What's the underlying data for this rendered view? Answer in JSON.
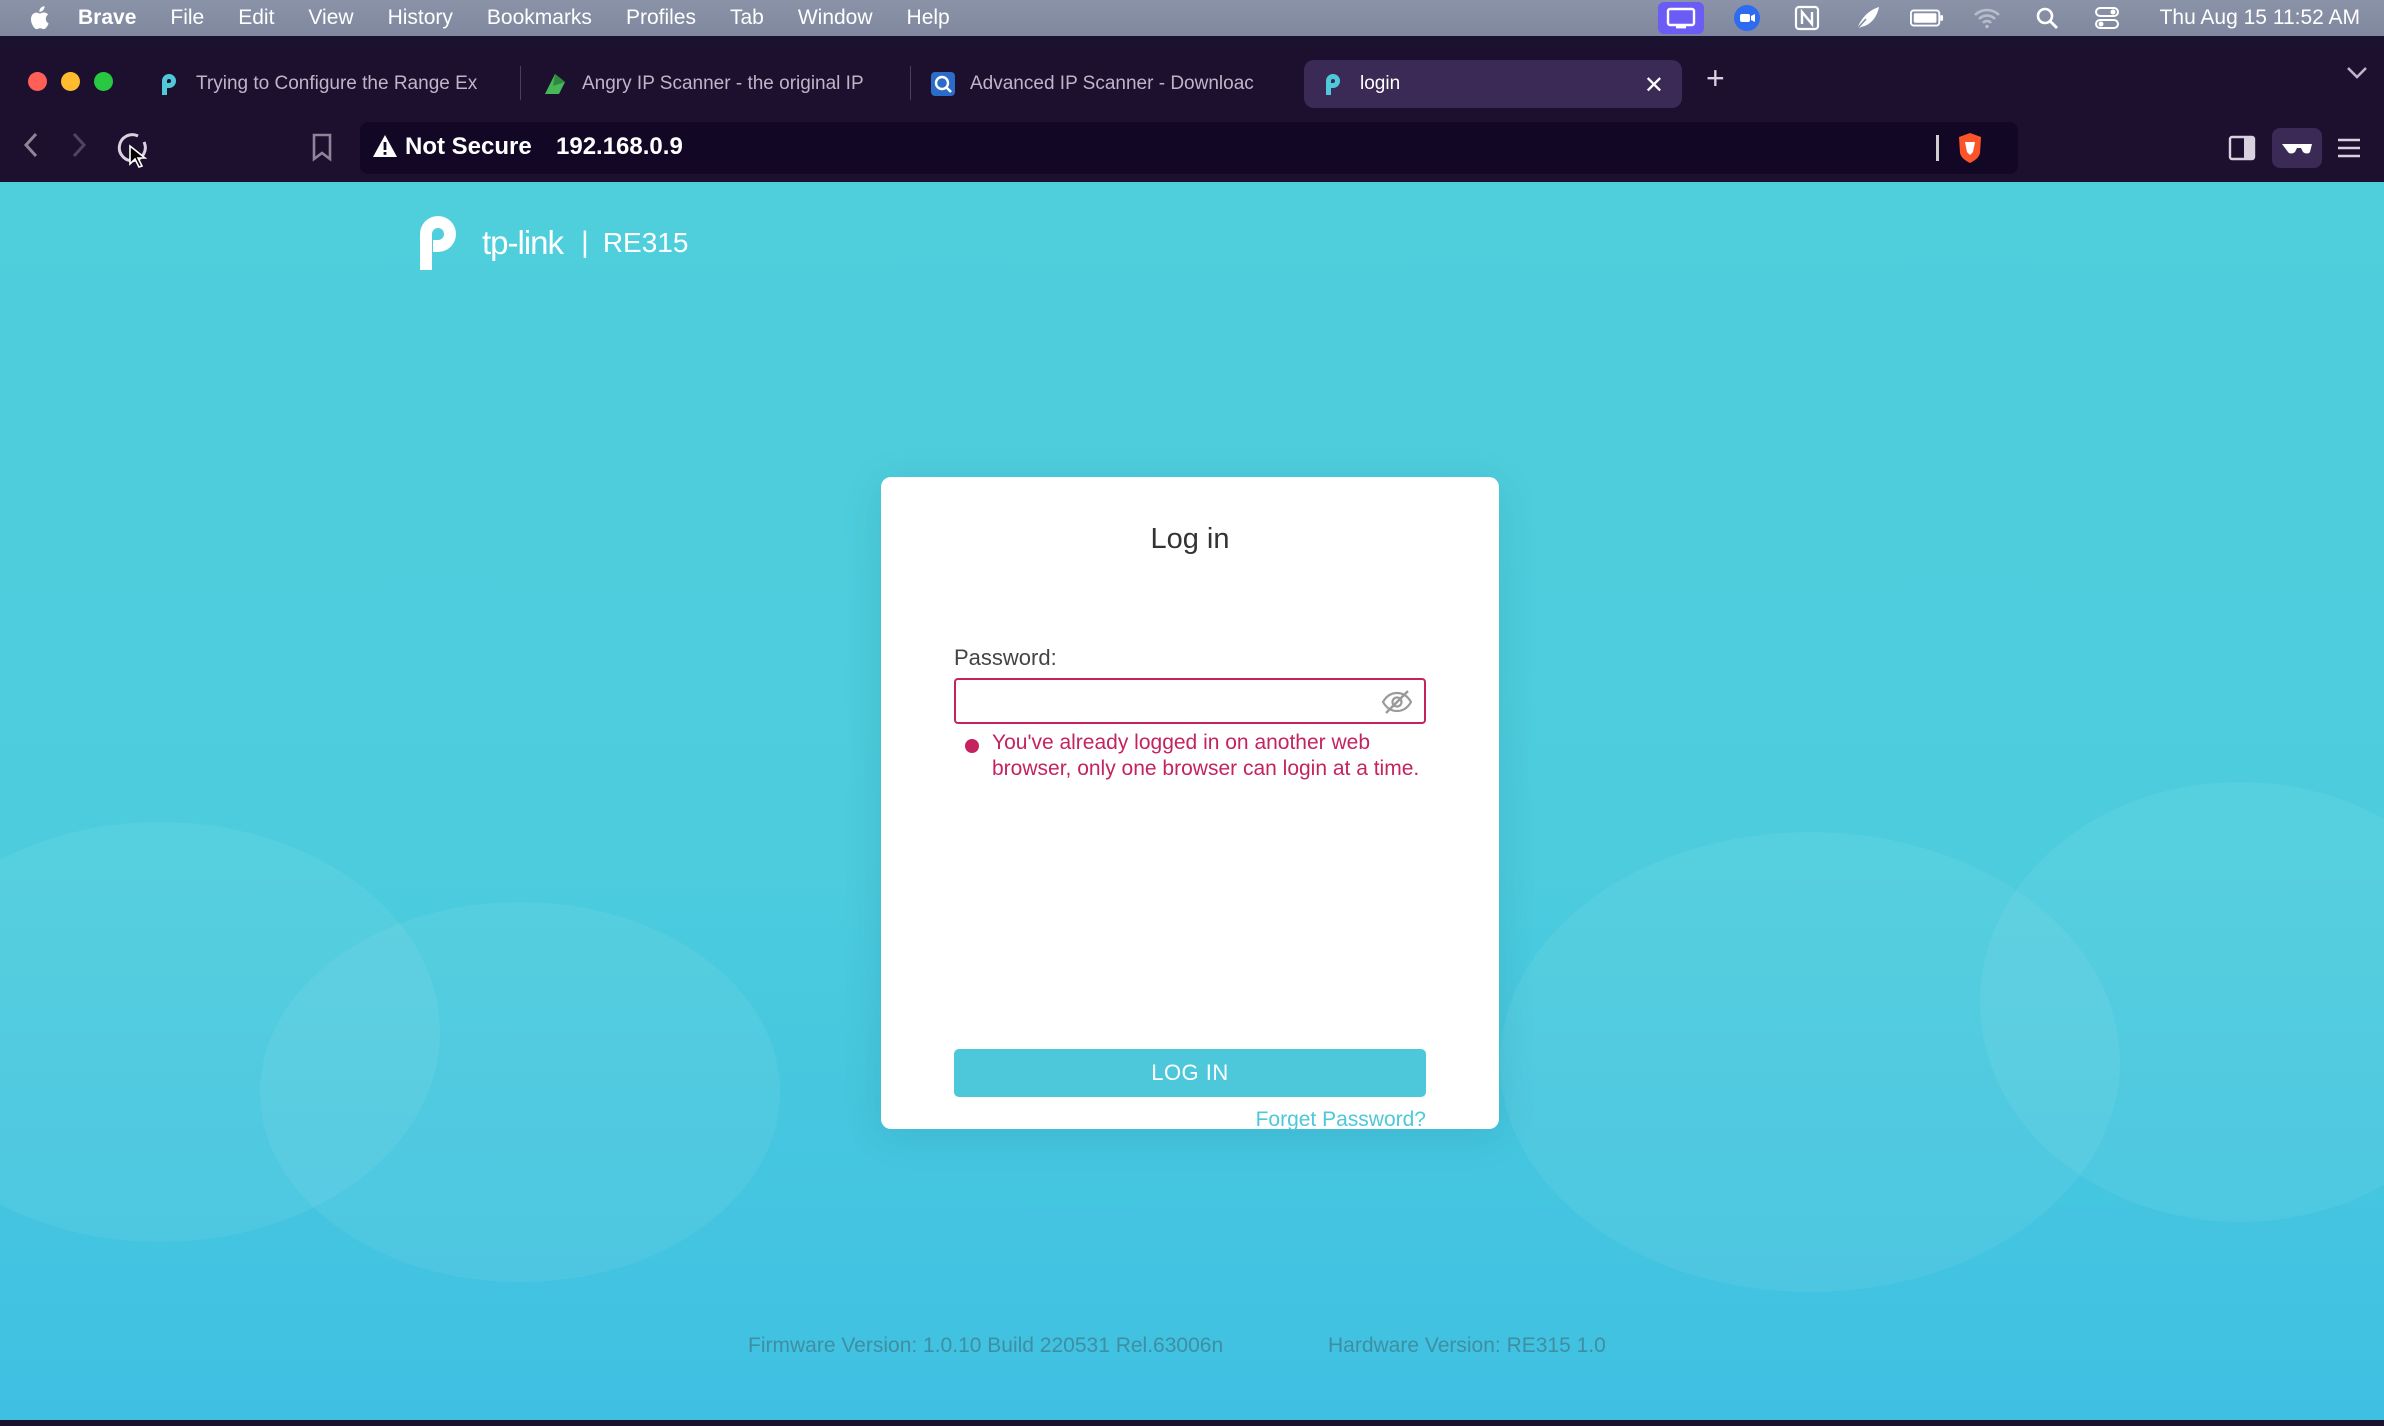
{
  "menubar": {
    "app": "Brave",
    "items": [
      "File",
      "Edit",
      "View",
      "History",
      "Bookmarks",
      "Profiles",
      "Tab",
      "Window",
      "Help"
    ],
    "clock": "Thu Aug 15  11:52 AM"
  },
  "tabs": [
    {
      "title": "Trying to Configure the Range Ex"
    },
    {
      "title": "Angry IP Scanner - the original IP"
    },
    {
      "title": "Advanced IP Scanner - Downloac"
    },
    {
      "title": "login"
    }
  ],
  "toolbar": {
    "security_label": "Not Secure",
    "url": "192.168.0.9"
  },
  "page": {
    "brand": "tp-link",
    "model": "RE315",
    "login": {
      "title": "Log in",
      "password_label": "Password:",
      "password_value": "",
      "error": "You've already logged in on another web browser, only one browser can login at a time.",
      "button": "LOG IN",
      "forget": "Forget Password?"
    },
    "firmware": "Firmware Version: 1.0.10 Build 220531 Rel.63006n",
    "hardware": "Hardware Version: RE315 1.0"
  },
  "colors": {
    "accent": "#4dc8da",
    "error": "#c4235f",
    "page_bg": "#4fcfdc",
    "browser_chrome": "#1d0f2e"
  }
}
